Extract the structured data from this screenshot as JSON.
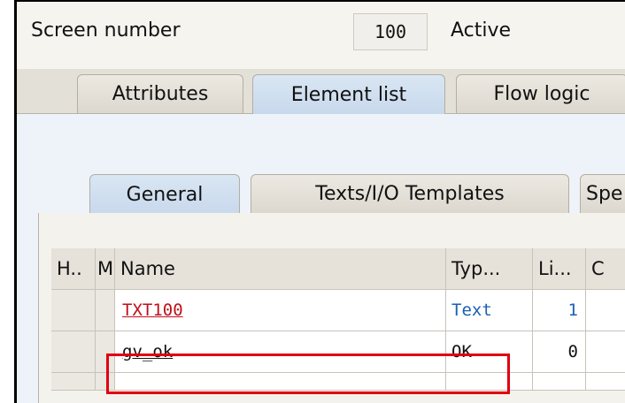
{
  "header": {
    "screen_label": "Screen number",
    "screen_value": "100",
    "status": "Active"
  },
  "main_tabs": [
    {
      "label": "Attributes",
      "active": false
    },
    {
      "label": "Element list",
      "active": true
    },
    {
      "label": "Flow logic",
      "active": false
    }
  ],
  "sub_tabs": [
    {
      "label": "General",
      "active": true
    },
    {
      "label": "Texts/I/O Templates",
      "active": false
    },
    {
      "label": "Spe",
      "active": false
    }
  ],
  "table": {
    "columns": [
      "H..",
      "M",
      "Name",
      "Typ...",
      "Li...",
      "C"
    ],
    "rows": [
      {
        "name": "TXT100",
        "type": "Text",
        "line": "1"
      },
      {
        "name": "gv_ok",
        "type": "OK",
        "line": "0"
      }
    ]
  },
  "colors": {
    "highlight": "#e00010",
    "link_red": "#c0101a",
    "value_blue": "#1a5fb4",
    "active_tab": "#c8d9ec"
  }
}
